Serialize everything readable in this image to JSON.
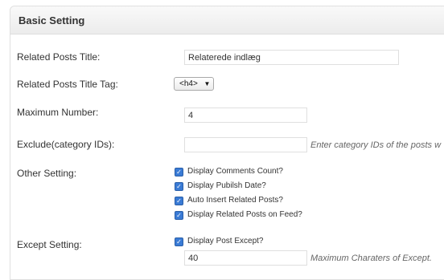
{
  "section": {
    "title": "Basic Setting"
  },
  "fields": {
    "related_title": {
      "label": "Related Posts Title:",
      "value": "Relaterede indlæg"
    },
    "title_tag": {
      "label": "Related Posts Title Tag:",
      "value": "<h4>"
    },
    "max_number": {
      "label": "Maximum Number:",
      "value": "4"
    },
    "exclude": {
      "label": "Exclude(category IDs):",
      "value": "",
      "hint": "Enter category IDs of the posts w"
    },
    "other": {
      "label": "Other Setting:",
      "options": [
        {
          "label": "Display Comments Count?",
          "checked": true
        },
        {
          "label": "Display Pubilsh Date?",
          "checked": true
        },
        {
          "label": "Auto Insert Related Posts?",
          "checked": true
        },
        {
          "label": "Display Related Posts on Feed?",
          "checked": true
        }
      ]
    },
    "except": {
      "label": "Except Setting:",
      "option": {
        "label": "Display Post Except?",
        "checked": true
      },
      "value": "40",
      "hint": "Maximum Charaters of Except."
    }
  },
  "icons": {
    "checkbox": "checkmark-icon",
    "dropdown": "chevron-down-icon"
  },
  "colors": {
    "checkbox": "#3a7bd5",
    "header_bg": "#ececec",
    "border": "#dfdfdf"
  }
}
